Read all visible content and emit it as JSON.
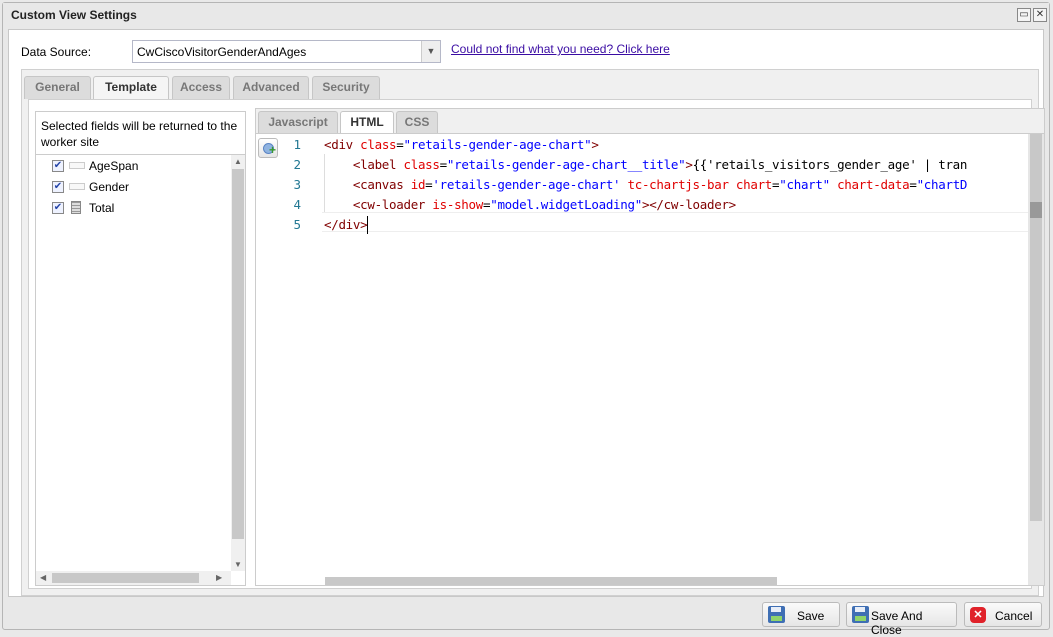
{
  "window": {
    "title": "Custom View Settings",
    "restore_icon": "restore-icon",
    "close_icon": "close-icon"
  },
  "data_source": {
    "label": "Data Source:",
    "value": "CwCiscoVisitorGenderAndAges",
    "help_link": "Could not find what you need? Click here"
  },
  "tabs": [
    {
      "label": "General",
      "active": false
    },
    {
      "label": "Template",
      "active": true
    },
    {
      "label": "Access",
      "active": false
    },
    {
      "label": "Advanced",
      "active": false
    },
    {
      "label": "Security",
      "active": false
    }
  ],
  "fields_panel": {
    "header": "Selected fields will be returned to the worker site",
    "fields": [
      {
        "label": "AgeSpan",
        "checked": true,
        "icon": "text-field-icon"
      },
      {
        "label": "Gender",
        "checked": true,
        "icon": "text-field-icon"
      },
      {
        "label": "Total",
        "checked": true,
        "icon": "calculator-icon"
      }
    ]
  },
  "editor": {
    "tabs": [
      {
        "label": "Javascript",
        "active": false
      },
      {
        "label": "HTML",
        "active": true
      },
      {
        "label": "CSS",
        "active": false
      }
    ],
    "lines": [
      {
        "num": "1",
        "tokens": [
          [
            "tag",
            "<div "
          ],
          [
            "attr",
            "class"
          ],
          [
            "txt",
            "="
          ],
          [
            "str",
            "\"retails-gender-age-chart\""
          ],
          [
            "tag",
            ">"
          ]
        ]
      },
      {
        "num": "2",
        "tokens": [
          [
            "txt",
            "    "
          ],
          [
            "tag",
            "<label "
          ],
          [
            "attr",
            "class"
          ],
          [
            "txt",
            "="
          ],
          [
            "str",
            "\"retails-gender-age-chart__title\""
          ],
          [
            "tag",
            ">"
          ],
          [
            "txt",
            "{{'retails_visitors_gender_age' | tran"
          ]
        ]
      },
      {
        "num": "3",
        "tokens": [
          [
            "txt",
            "    "
          ],
          [
            "tag",
            "<canvas "
          ],
          [
            "attr",
            "id"
          ],
          [
            "txt",
            "="
          ],
          [
            "str",
            "'retails-gender-age-chart'"
          ],
          [
            "attr",
            " tc-chartjs-bar chart"
          ],
          [
            "txt",
            "="
          ],
          [
            "str",
            "\"chart\""
          ],
          [
            "attr",
            " chart-data"
          ],
          [
            "txt",
            "="
          ],
          [
            "str",
            "\"chartD"
          ]
        ]
      },
      {
        "num": "4",
        "tokens": [
          [
            "txt",
            "    "
          ],
          [
            "tag",
            "<cw-loader "
          ],
          [
            "attr",
            "is-show"
          ],
          [
            "txt",
            "="
          ],
          [
            "str",
            "\"model.widgetLoading\""
          ],
          [
            "tag",
            "></cw-loader>"
          ]
        ]
      },
      {
        "num": "5",
        "tokens": [
          [
            "tag",
            "</div>"
          ]
        ]
      }
    ]
  },
  "buttons": {
    "save": "Save",
    "save_close": "Save And Close",
    "cancel": "Cancel"
  },
  "colors": {
    "tag": "#800000",
    "attribute": "#e00000",
    "string": "#0000ff",
    "line_number": "#237893",
    "cancel_icon": "#e0222a",
    "save_icon": "#3f6fb4"
  }
}
